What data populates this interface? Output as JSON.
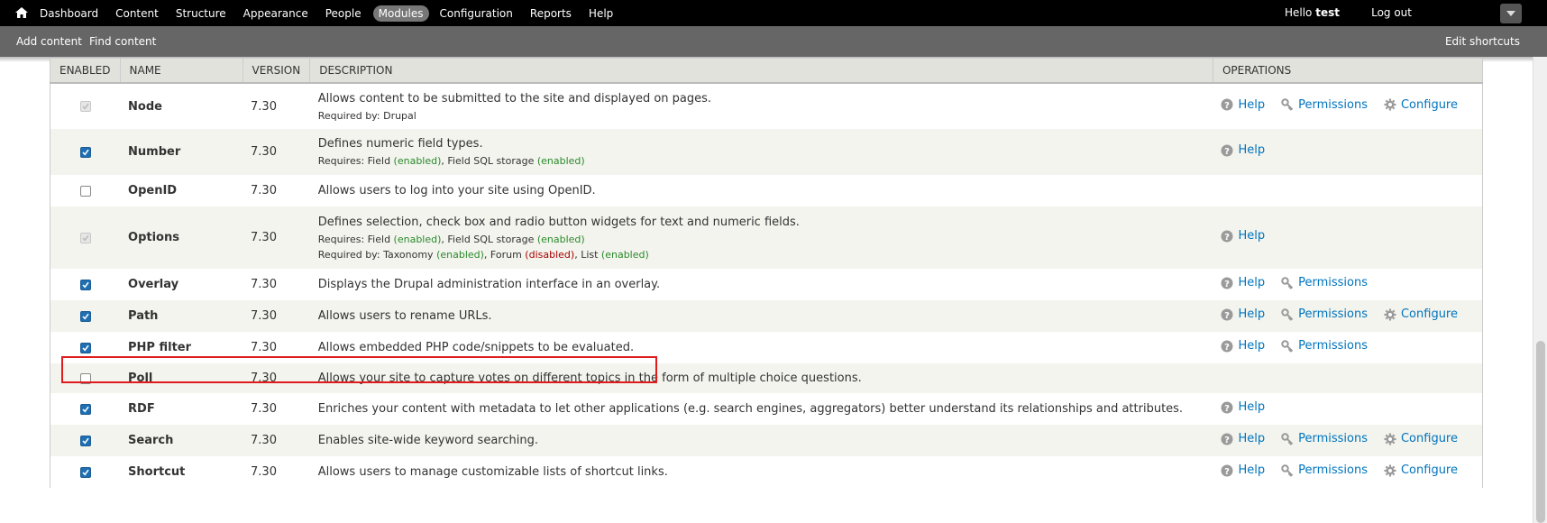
{
  "toolbar": {
    "menu": [
      "Dashboard",
      "Content",
      "Structure",
      "Appearance",
      "People",
      "Modules",
      "Configuration",
      "Reports",
      "Help"
    ],
    "active": "Modules",
    "greeting": "Hello",
    "username": "test",
    "logout": "Log out"
  },
  "shortcuts": {
    "add_content": "Add content",
    "find_content": "Find content",
    "edit": "Edit shortcuts"
  },
  "table": {
    "headers": {
      "enabled": "ENABLED",
      "name": "NAME",
      "version": "VERSION",
      "description": "DESCRIPTION",
      "operations": "OPERATIONS"
    },
    "rows": [
      {
        "name": "Node",
        "version": "7.30",
        "checkbox": "disabled-checked",
        "description": "Allows content to be submitted to the site and displayed on pages.",
        "required_by_label": "Required by:",
        "required_by": [
          {
            "text": "Drupal"
          }
        ],
        "ops": [
          "help",
          "permissions",
          "configure"
        ]
      },
      {
        "name": "Number",
        "version": "7.30",
        "checkbox": "checked",
        "description": "Defines numeric field types.",
        "requires_label": "Requires:",
        "requires": [
          {
            "text": "Field",
            "status": "(enabled)"
          },
          {
            "text": "Field SQL storage",
            "status": "(enabled)"
          }
        ],
        "ops": [
          "help"
        ]
      },
      {
        "name": "OpenID",
        "version": "7.30",
        "checkbox": "unchecked",
        "description": "Allows users to log into your site using OpenID.",
        "ops": []
      },
      {
        "name": "Options",
        "version": "7.30",
        "checkbox": "disabled-checked",
        "description": "Defines selection, check box and radio button widgets for text and numeric fields.",
        "requires_label": "Requires:",
        "requires": [
          {
            "text": "Field",
            "status": "(enabled)"
          },
          {
            "text": "Field SQL storage",
            "status": "(enabled)"
          }
        ],
        "required_by_label": "Required by:",
        "required_by": [
          {
            "text": "Taxonomy",
            "status": "(enabled)"
          },
          {
            "text": "Forum",
            "status": "(disabled)"
          },
          {
            "text": "List",
            "status": "(enabled)"
          }
        ],
        "ops": [
          "help"
        ]
      },
      {
        "name": "Overlay",
        "version": "7.30",
        "checkbox": "checked",
        "description": "Displays the Drupal administration interface in an overlay.",
        "ops": [
          "help",
          "permissions"
        ]
      },
      {
        "name": "Path",
        "version": "7.30",
        "checkbox": "checked",
        "description": "Allows users to rename URLs.",
        "ops": [
          "help",
          "permissions",
          "configure"
        ]
      },
      {
        "name": "PHP filter",
        "version": "7.30",
        "checkbox": "checked",
        "description": "Allows embedded PHP code/snippets to be evaluated.",
        "ops": [
          "help",
          "permissions"
        ]
      },
      {
        "name": "Poll",
        "version": "7.30",
        "checkbox": "unchecked",
        "description": "Allows your site to capture votes on different topics in the form of multiple choice questions.",
        "ops": []
      },
      {
        "name": "RDF",
        "version": "7.30",
        "checkbox": "checked",
        "description": "Enriches your content with metadata to let other applications (e.g. search engines, aggregators) better understand its relationships and attributes.",
        "ops": [
          "help"
        ]
      },
      {
        "name": "Search",
        "version": "7.30",
        "checkbox": "checked",
        "description": "Enables site-wide keyword searching.",
        "ops": [
          "help",
          "permissions",
          "configure"
        ]
      },
      {
        "name": "Shortcut",
        "version": "7.30",
        "checkbox": "checked",
        "description": "Allows users to manage customizable lists of shortcut links.",
        "ops": [
          "help",
          "permissions",
          "configure"
        ]
      }
    ]
  },
  "op_labels": {
    "help": "Help",
    "permissions": "Permissions",
    "configure": "Configure"
  },
  "icons": {
    "home": "home-icon",
    "help": "help-icon",
    "permissions": "key-icon",
    "configure": "gear-icon",
    "drawer": "chevron-down-icon"
  },
  "colors": {
    "link": "#0074bd",
    "enabled": "#2a8a2a",
    "disabled": "#a80000",
    "highlight": "#e01b1b",
    "checkbox": "#1f6fb2"
  }
}
